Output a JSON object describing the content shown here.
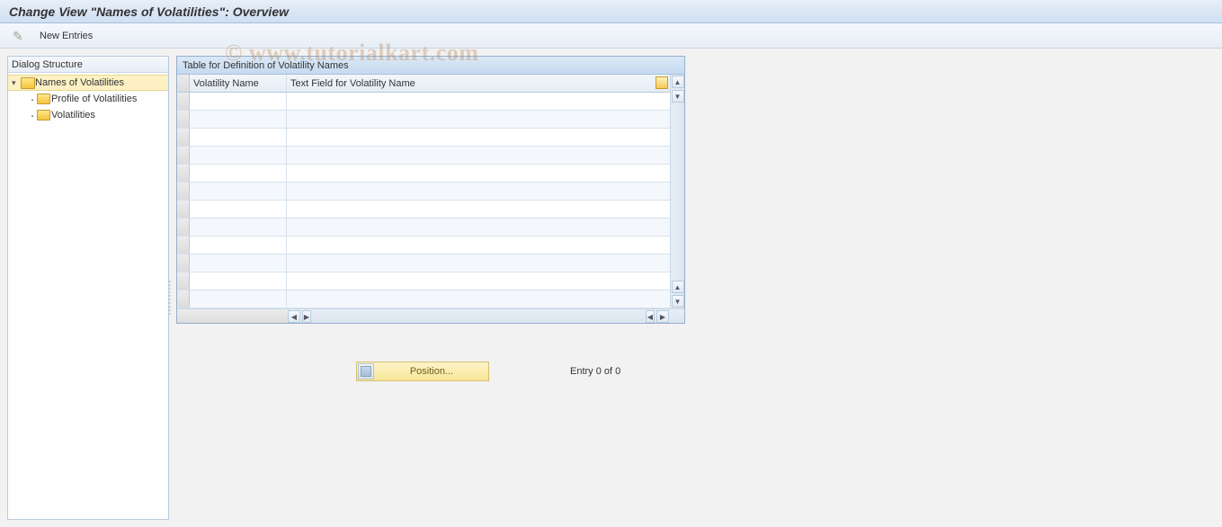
{
  "title": "Change View \"Names of Volatilities\": Overview",
  "toolbar": {
    "new_entries_label": "New Entries"
  },
  "tree": {
    "header": "Dialog Structure",
    "root": "Names of Volatilities",
    "child1": "Profile of Volatilities",
    "child2": "Volatilities"
  },
  "table": {
    "title": "Table for Definition of Volatility Names",
    "col1": "Volatility Name",
    "col2": "Text Field for Volatility Name"
  },
  "footer": {
    "position_label": "Position...",
    "entry_text": "Entry 0 of 0"
  },
  "watermark": "© www.tutorialkart.com"
}
